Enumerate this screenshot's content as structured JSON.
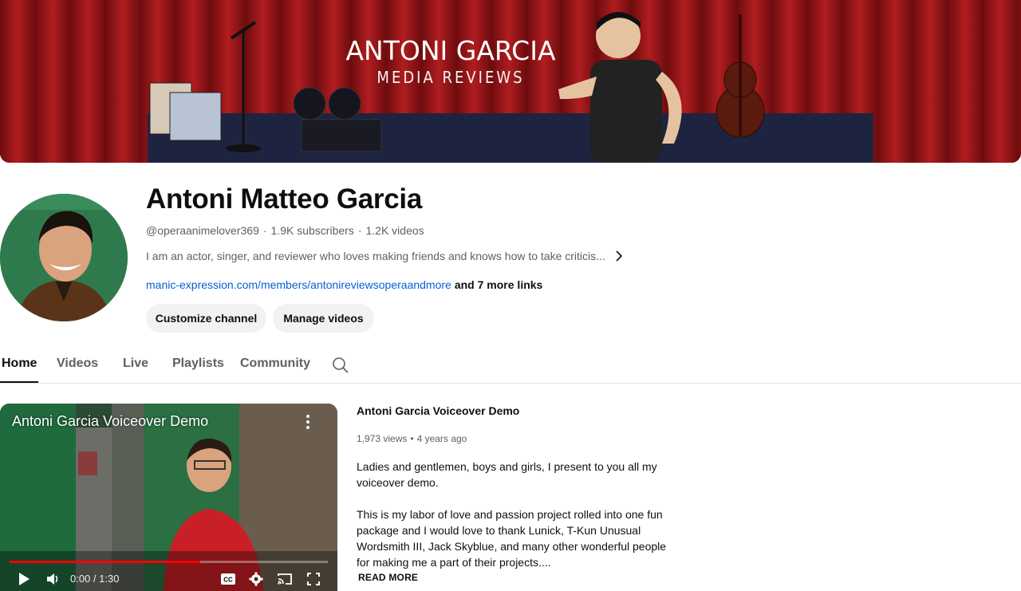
{
  "banner": {
    "title": "ANTONI GARCIA",
    "subtitle": "MEDIA REVIEWS"
  },
  "channel": {
    "name": "Antoni Matteo Garcia",
    "handle": "@operaanimelover369",
    "subscribers": "1.9K subscribers",
    "videos": "1.2K videos",
    "separator": "·",
    "description": "I am an actor, singer, and reviewer who loves making friends and knows how to take criticis...",
    "link": "manic-expression.com/members/antonireviewsoperaandmore",
    "more_links": "and 7 more links"
  },
  "actions": {
    "customize": "Customize channel",
    "manage": "Manage videos"
  },
  "tabs": [
    {
      "label": "Home",
      "active": true
    },
    {
      "label": "Videos",
      "active": false
    },
    {
      "label": "Live",
      "active": false
    },
    {
      "label": "Playlists",
      "active": false
    },
    {
      "label": "Community",
      "active": false
    }
  ],
  "player": {
    "title": "Antoni Garcia Voiceover Demo",
    "time": "0:00 / 1:30",
    "progress": 0.6
  },
  "video": {
    "title": "Antoni Garcia Voiceover Demo",
    "views": "1,973 views",
    "age": "4 years ago",
    "separator": "•",
    "desc1": "Ladies and gentlemen, boys and girls, I present to you all my voiceover demo.",
    "desc2": "This is my labor of love and passion project rolled into one fun package and I would love to thank Lunick, T-Kun Unusual Wordsmith III, Jack Skyblue, and many other wonderful people for making me a part of their projects....",
    "read_more": "READ MORE"
  },
  "icons": {
    "chevron": "chevron-right-icon",
    "search": "search-icon",
    "more": "more-vert-icon",
    "play": "play-icon",
    "volume": "volume-icon",
    "cc": "cc-icon",
    "settings": "settings-icon",
    "cast": "cast-icon",
    "fullscreen": "fullscreen-icon"
  },
  "colors": {
    "banner_red": "#8f1416",
    "link_blue": "#065fd4",
    "progress_red": "#ff0000"
  }
}
